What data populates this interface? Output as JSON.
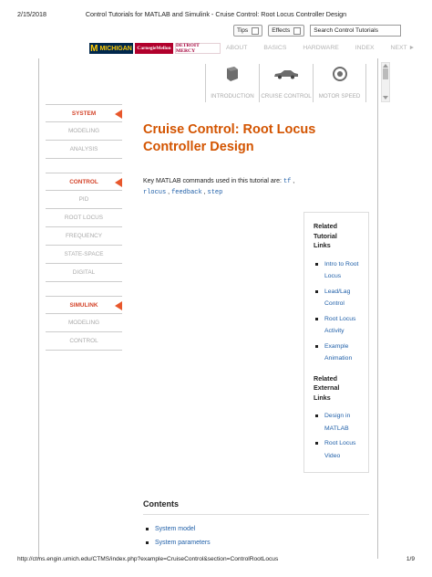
{
  "print": {
    "date": "2/15/2018",
    "title": "Control Tutorials for MATLAB and Simulink - Cruise Control: Root Locus Controller Design",
    "url": "http://ctms.engin.umich.edu/CTMS/index.php?example=CruiseControl&section=ControlRootLocus",
    "page": "1/9"
  },
  "toolbar": {
    "tips_label": "Tips",
    "effects_label": "Effects",
    "search_value": "Search Control Tutorials"
  },
  "logos": {
    "michigan_m": "M",
    "michigan": "MICHIGAN",
    "cmu": "CarnegieMellon",
    "udm": "DETROIT MERCY"
  },
  "topnav": {
    "about": "ABOUT",
    "basics": "BASICS",
    "hardware": "HARDWARE",
    "index": "INDEX",
    "next": "NEXT ►"
  },
  "tabs": {
    "introduction": "INTRODUCTION",
    "cruise_control": "CRUISE CONTROL",
    "motor_speed": "MOTOR SPEED"
  },
  "sidebar": {
    "system": "SYSTEM",
    "system_modeling": "MODELING",
    "system_analysis": "ANALYSIS",
    "control": "CONTROL",
    "pid": "PID",
    "root_locus": "ROOT LOCUS",
    "frequency": "FREQUENCY",
    "state_space": "STATE-SPACE",
    "digital": "DIGITAL",
    "simulink": "SIMULINK",
    "simulink_modeling": "MODELING",
    "simulink_control": "CONTROL"
  },
  "main": {
    "title": "Cruise Control: Root Locus Controller Design",
    "intro_text": "Key MATLAB commands used in this tutorial are: ",
    "cmd_tf": "tf",
    "cmd_rlocus": "rlocus",
    "cmd_feedback": "feedback",
    "cmd_step": "step",
    "comma": " , ",
    "comma_end": " ,"
  },
  "related": {
    "tutorial_heading": "Related Tutorial Links",
    "tutorial_links": [
      "Intro to Root Locus",
      "Lead/Lag Control",
      "Root Locus Activity",
      "Example Animation"
    ],
    "external_heading": "Related External Links",
    "external_links": [
      "Design in MATLAB",
      "Root Locus Video"
    ]
  },
  "contents": {
    "title": "Contents",
    "items": [
      "System model",
      "System parameters"
    ]
  }
}
